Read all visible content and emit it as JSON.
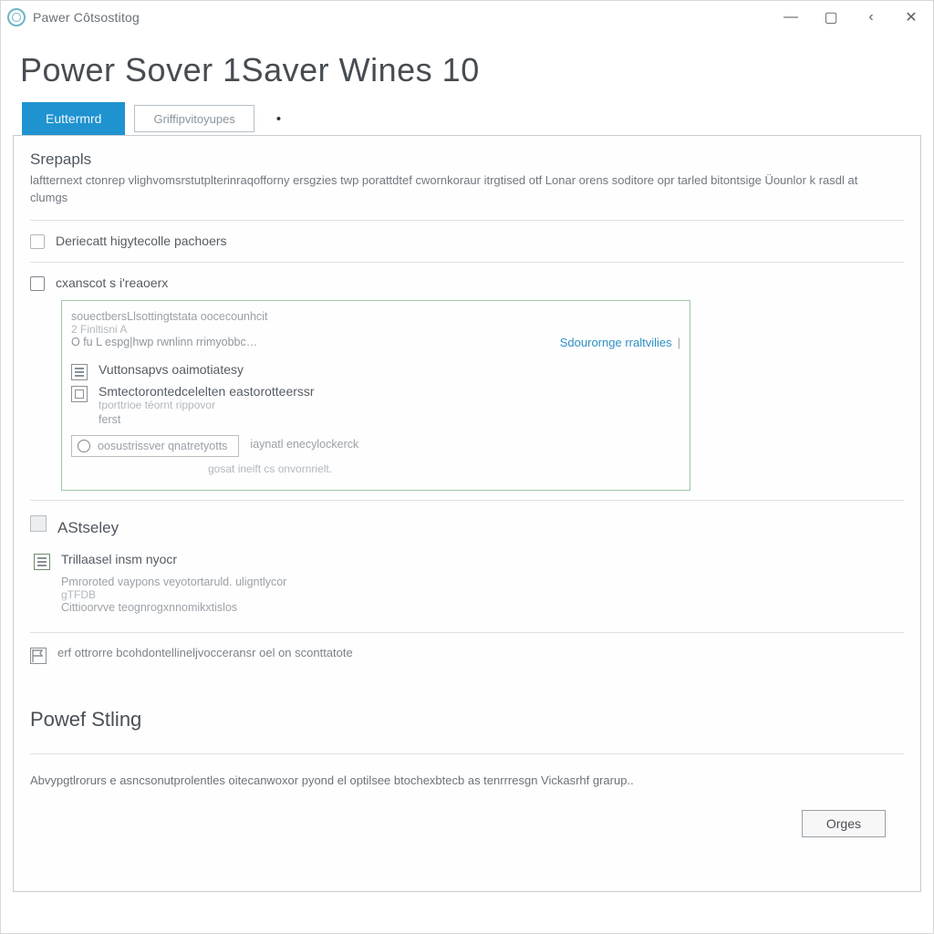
{
  "window": {
    "title": "Pawer Côtsostitog",
    "controls": {
      "minimize": "—",
      "maximize": "▢",
      "back": "‹",
      "close": "✕"
    }
  },
  "page": {
    "heading": "Power Sover 1Saver Wines 10"
  },
  "tabs": {
    "active": "Euttermrd",
    "secondary": "Griffipvitoyupes"
  },
  "intro": {
    "title": "Srepapls",
    "desc": "laftternext ctonrep vlighvomsrstutplterinraqofforny ersgzies twp porattdtef cwornkoraur itrgtised otf Lonar orens soditore opr tarled bitontsige Üounlor k rasdl at clumgs"
  },
  "options": {
    "opt1": "Deriecatt higytecolle pachoers",
    "opt2": "cxanscot s i'reaoerx",
    "sub1": "souectbersLlsottingtstata  oocecounhcit",
    "sub1b": "2 Finltisni A",
    "sub1c": "O fu L espg|hwp rwnlinn rrimyobbc…",
    "link1": "Sdourornge rraltvilies"
  },
  "group": {
    "g1_label": "Vuttonsapvs oaimotiatesy",
    "g2_label": "Smtectorontedcelelten eastorotteerssr",
    "g2_sub": "tporttrioe téornt rippovor",
    "g3_label": "ferst",
    "chip": "oosustrissver qnatretyotts",
    "chip_side": "iaynatl enecylockerck",
    "chip_under": "gosat ineift cs onvornrielt."
  },
  "astseley": {
    "title": "AStseley",
    "row1": "Trillaasel insm nyocr",
    "row1_desc1": "Pmroroted   vaypons veyotortaruld. uligntlycor",
    "row1_desc2": "gTFDB",
    "row1_desc3": "Cittioorvve teognrogxnnomikxtislos",
    "row2": "erf ottrorre  bcohdontellineljvocceransr oel  on sconttatote"
  },
  "power": {
    "title": "Powef Stling",
    "desc": "Abvypgtlrorurs e asncsonutprolentles oitecanwoxor pyond el optilsee btochexbtecb as tenrrresgn Vickasrhf grarup.."
  },
  "footer": {
    "button": "Orges"
  }
}
